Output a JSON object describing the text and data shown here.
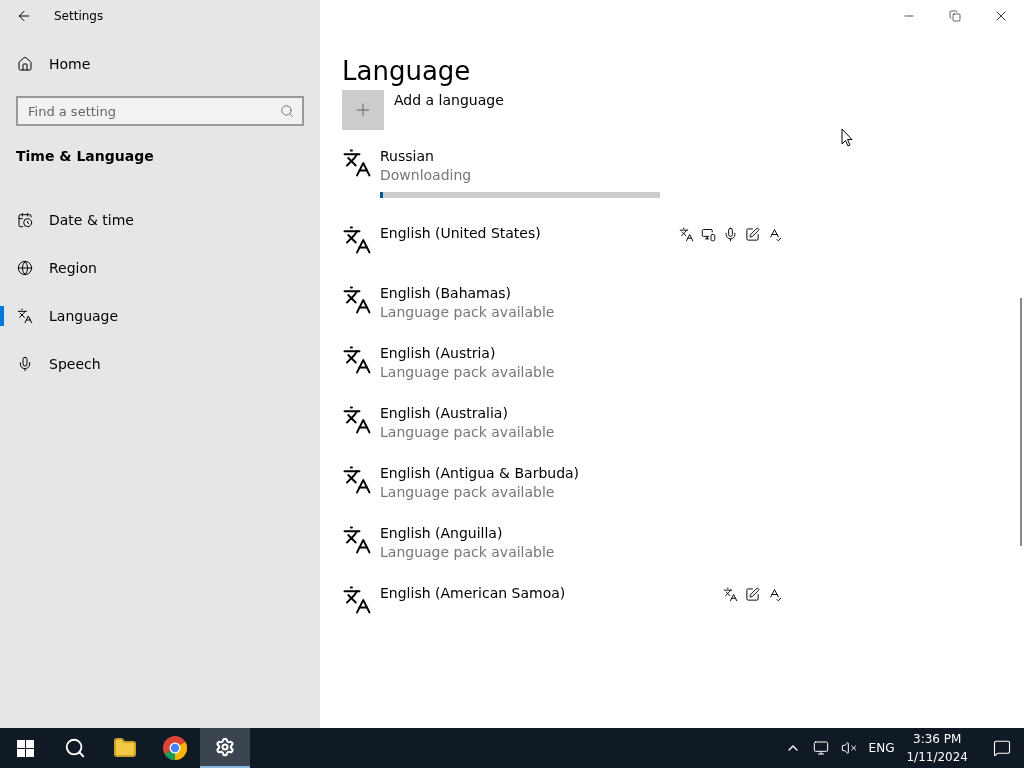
{
  "window": {
    "title": "Settings"
  },
  "sidebar": {
    "home": "Home",
    "search": {
      "placeholder": "Find a setting"
    },
    "section": "Time & Language",
    "items": [
      {
        "label": "Date & time",
        "kind": "date",
        "selected": false
      },
      {
        "label": "Region",
        "kind": "region",
        "selected": false
      },
      {
        "label": "Language",
        "kind": "language",
        "selected": true
      },
      {
        "label": "Speech",
        "kind": "speech",
        "selected": false
      }
    ]
  },
  "main": {
    "heading": "Language",
    "add_button": "Add a language",
    "languages": [
      {
        "name": "Russian",
        "status": "Downloading",
        "kind": "downloading",
        "level": 0.01
      },
      {
        "name": "English (United States)",
        "kind": "installed",
        "features": [
          {
            "kind": "language"
          },
          {
            "kind": "display"
          },
          {
            "kind": "speech"
          },
          {
            "kind": "handwriting"
          },
          {
            "kind": "spelling"
          }
        ]
      },
      {
        "name": "English (Bahamas)",
        "status": "Language pack available",
        "kind": "available"
      },
      {
        "name": "English (Austria)",
        "status": "Language pack available",
        "kind": "available"
      },
      {
        "name": "English (Australia)",
        "status": "Language pack available",
        "kind": "available"
      },
      {
        "name": "English (Antigua & Barbuda)",
        "status": "Language pack available",
        "kind": "available"
      },
      {
        "name": "English (Anguilla)",
        "status": "Language pack available",
        "kind": "available"
      },
      {
        "name": "English (American Samoa)",
        "kind": "installed",
        "features": [
          {
            "kind": "language"
          },
          {
            "kind": "handwriting"
          },
          {
            "kind": "spelling"
          }
        ]
      }
    ]
  },
  "taskbar": {
    "apps": [
      {
        "kind": "start",
        "active": false
      },
      {
        "kind": "search",
        "active": false
      },
      {
        "kind": "files",
        "active": false
      },
      {
        "kind": "browser",
        "active": false
      },
      {
        "kind": "settings",
        "active": true
      }
    ],
    "tray": {
      "language": "ENG",
      "time": "3:36 PM",
      "date": "1/11/2024"
    }
  }
}
